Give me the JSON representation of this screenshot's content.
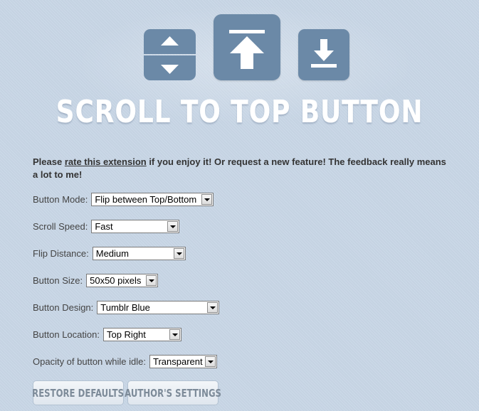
{
  "header": {
    "title": "SCROLL TO TOP BUTTON",
    "icons": [
      "flip-up-down-icon",
      "scroll-to-top-icon",
      "scroll-to-bottom-icon"
    ],
    "tile_color": "#6b89a7"
  },
  "notice": {
    "before": "Please ",
    "link": "rate this extension",
    "after": " if you enjoy it! Or request a new feature! The feedback really means a lot to me!"
  },
  "settings": {
    "button_mode": {
      "label": "Button Mode:",
      "value": "Flip between Top/Bottom"
    },
    "scroll_speed": {
      "label": "Scroll Speed:",
      "value": "Fast"
    },
    "flip_distance": {
      "label": "Flip Distance:",
      "value": "Medium"
    },
    "button_size": {
      "label": "Button Size:",
      "value": "50x50 pixels"
    },
    "button_design": {
      "label": "Button Design:",
      "value": "Tumblr Blue"
    },
    "button_location": {
      "label": "Button Location:",
      "value": "Top Right"
    },
    "opacity": {
      "label": "Opacity of button while idle:",
      "value": "Transparent"
    }
  },
  "actions": {
    "restore": "RESTORE DEFAULTS",
    "author": "AUTHOR'S SETTINGS"
  },
  "colors": {
    "background": "#c9d7e7",
    "button_text": "#7d8b99"
  }
}
